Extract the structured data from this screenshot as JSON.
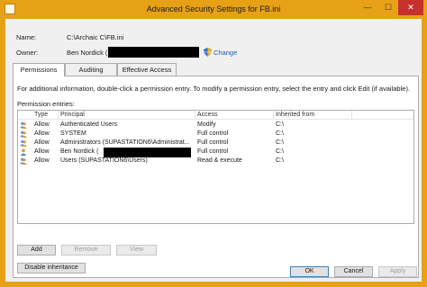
{
  "window": {
    "title": "Advanced Security Settings for FB.ini",
    "minimize": "—",
    "maximize": "☐",
    "close": "✕"
  },
  "header": {
    "name_label": "Name:",
    "name_value": "C:\\Archaic C\\FB.ini",
    "owner_label": "Owner:",
    "owner_value": "Ben Nordick (",
    "change_label": "Change"
  },
  "tabs": [
    {
      "label": "Permissions",
      "active": true
    },
    {
      "label": "Auditing",
      "active": false
    },
    {
      "label": "Effective Access",
      "active": false
    }
  ],
  "permissions": {
    "info_text": "For additional information, double-click a permission entry. To modify a permission entry, select the entry and click Edit (if available).",
    "entries_label": "Permission entries:",
    "columns": [
      "Type",
      "Principal",
      "Access",
      "Inherited from"
    ],
    "rows": [
      {
        "type": "Allow",
        "principal": "Authenticated Users",
        "access": "Modify",
        "inherited": "C:\\",
        "icon": "group-icon"
      },
      {
        "type": "Allow",
        "principal": "SYSTEM",
        "access": "Full control",
        "inherited": "C:\\",
        "icon": "group-icon"
      },
      {
        "type": "Allow",
        "principal": "Administrators (SUPASTATION6\\Administrat...",
        "access": "Full control",
        "inherited": "C:\\",
        "icon": "group-icon"
      },
      {
        "type": "Allow",
        "principal": "Ben Nordick (",
        "access": "Full control",
        "inherited": "C:\\",
        "icon": "user-icon"
      },
      {
        "type": "Allow",
        "principal": "Users (SUPASTATION6\\Users)",
        "access": "Read & execute",
        "inherited": "C:\\",
        "icon": "group-icon"
      }
    ]
  },
  "buttons": {
    "add": "Add",
    "remove": "Remove",
    "view": "View",
    "disable_inheritance": "Disable inheritance",
    "ok": "OK",
    "cancel": "Cancel",
    "apply": "Apply"
  },
  "colors": {
    "titlebar": "#e7a117",
    "close": "#c7312b",
    "link": "#1a5aba"
  }
}
